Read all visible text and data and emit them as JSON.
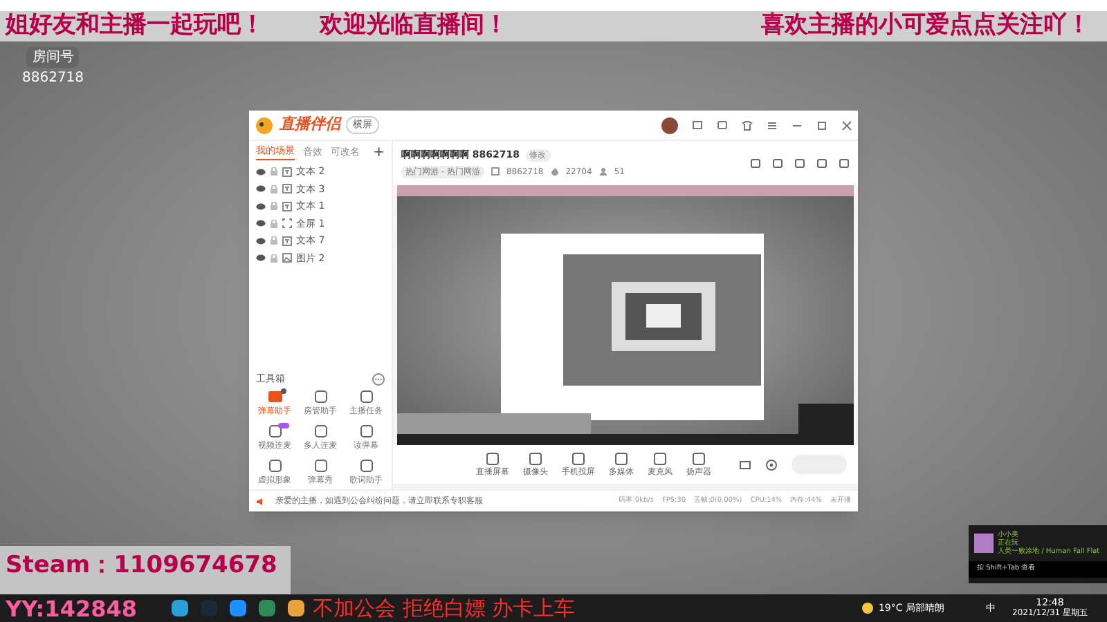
{
  "overlay": {
    "banner": [
      "姐好友和主播一起玩吧！",
      "欢迎光临直播间！",
      "喜欢主播的小可爱点点关注吖！"
    ],
    "room_label": "房间号",
    "room_number": "8862718",
    "steam": "Steam：1109674678",
    "yy": "YY:142848",
    "slogan": "不加公会 拒绝白嫖 办卡上车"
  },
  "app": {
    "logo": "直播伴侣",
    "mode": "横屏",
    "scene_tabs": [
      {
        "label": "我的场景",
        "selected": true
      },
      {
        "label": "音效",
        "selected": false
      },
      {
        "label": "可改名",
        "selected": false
      }
    ],
    "add": "+",
    "sources": [
      {
        "kind": "text",
        "label": "文本 2"
      },
      {
        "kind": "text",
        "label": "文本 3"
      },
      {
        "kind": "text",
        "label": "文本 1"
      },
      {
        "kind": "screen",
        "label": "全屏 1"
      },
      {
        "kind": "text",
        "label": "文本 7"
      },
      {
        "kind": "image",
        "label": "图片 2"
      }
    ],
    "toolbox_title": "工具箱",
    "tools": [
      {
        "label": "弹幕助手",
        "kind": "dot"
      },
      {
        "label": "房管助手",
        "kind": "plain"
      },
      {
        "label": "主播任务",
        "kind": "plain"
      },
      {
        "label": "视频连麦",
        "kind": "new"
      },
      {
        "label": "多人连麦",
        "kind": "plain"
      },
      {
        "label": "读弹幕",
        "kind": "plain"
      },
      {
        "label": "虚拟形象",
        "kind": "plain"
      },
      {
        "label": "弹幕秀",
        "kind": "plain"
      },
      {
        "label": "歌词助手",
        "kind": "plain"
      }
    ],
    "notice": "亲爱的主播，如遇到公会纠纷问题，请立即联系专职客服",
    "room": {
      "title": "啊啊啊啊啊啊啊 8862718",
      "edit": "修改",
      "category": "热门网游 - 热门网游",
      "room_id": "8862718",
      "heat": "22704",
      "fans": "51"
    },
    "controls": [
      "直播屏幕",
      "摄像头",
      "手机投屏",
      "多媒体",
      "麦克风",
      "扬声器"
    ],
    "stats": [
      "码率:0kb/s",
      "FPS:30",
      "丢帧:0(0.00%)",
      "CPU:14%",
      "内存:44%",
      "未开播"
    ]
  },
  "game_popup": {
    "name": "小小美",
    "status": "正在玩",
    "game": "人类一败涂地 / Human Fall Flat",
    "hint": "按 Shift+Tab 查看"
  },
  "taskbar": {
    "weather": "19°C 局部晴朗",
    "ime": "中",
    "time": "12:48",
    "date": "2021/12/31 星期五"
  }
}
